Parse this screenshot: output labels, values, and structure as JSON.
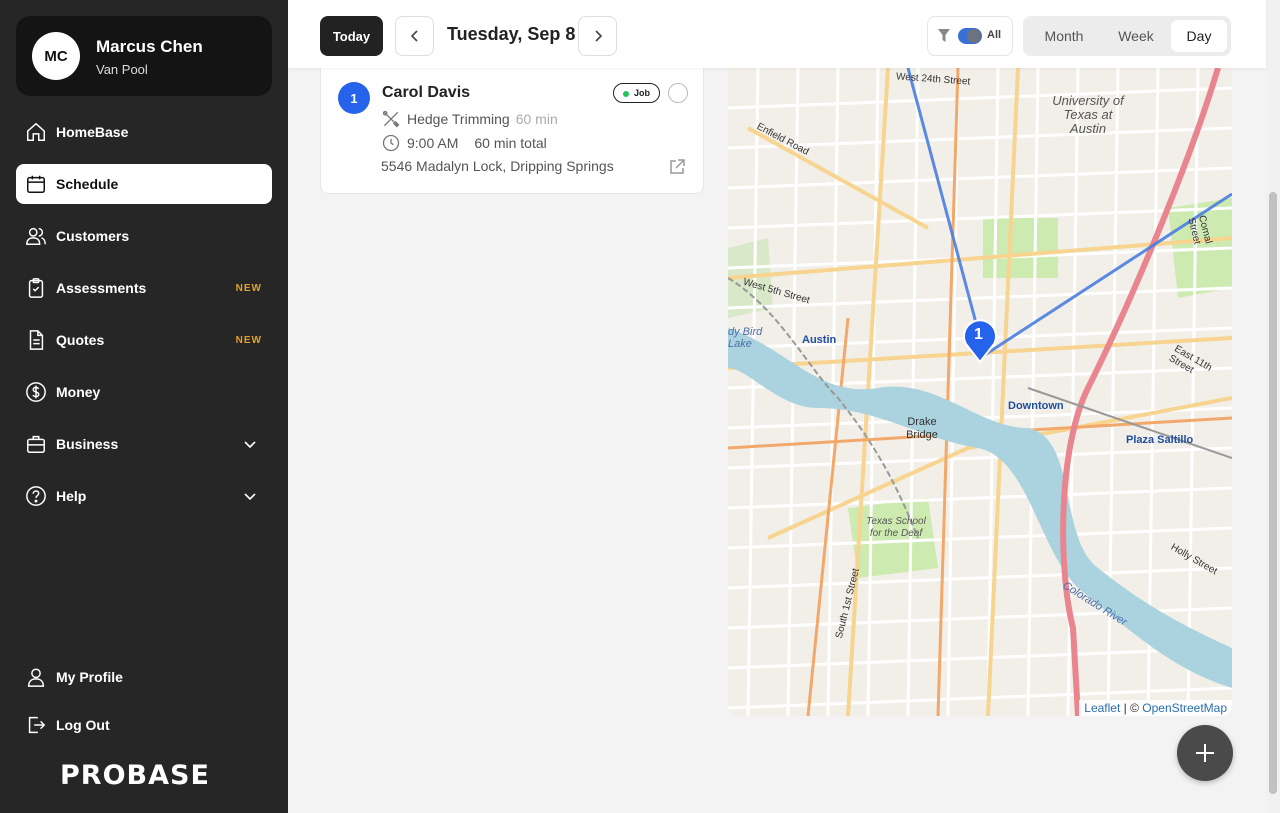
{
  "user": {
    "initials": "MC",
    "name": "Marcus Chen",
    "role": "Van Pool"
  },
  "nav": {
    "homebase": "HomeBase",
    "schedule": "Schedule",
    "customers": "Customers",
    "assessments": "Assessments",
    "assessments_badge": "NEW",
    "quotes": "Quotes",
    "quotes_badge": "NEW",
    "money": "Money",
    "business": "Business",
    "help": "Help",
    "profile": "My Profile",
    "logout": "Log Out"
  },
  "logo": "PROBASE",
  "toolbar": {
    "today": "Today",
    "date": "Tuesday, Sep 8",
    "filter_label": "All",
    "views": [
      "Month",
      "Week",
      "Day"
    ],
    "active_view": "Day"
  },
  "job": {
    "number": "1",
    "customer": "Carol Davis",
    "type_badge": "Job",
    "service": "Hedge Trimming",
    "service_duration": "60 min",
    "time": "9:00 AM",
    "total": "60 min total",
    "address": "5546 Madalyn Lock, Dripping Springs"
  },
  "map": {
    "labels": {
      "university": "University of Texas at Austin",
      "austin": "Austin",
      "downtown": "Downtown",
      "drake": "Drake Bridge",
      "plaza": "Plaza Saltillo",
      "texas_school": "Texas School for the Deaf",
      "colorado": "Colorado River",
      "lady_bird": "dy Bird Lake",
      "w24": "West 24th Street",
      "w5": "West 5th Street",
      "enfield": "Enfield Road",
      "e11": "East 11th Street",
      "holly": "Holly Street",
      "s1st": "South 1st Street",
      "comal": "Comal Street"
    },
    "marker": "1",
    "attribution_leaflet": "Leaflet",
    "attribution_sep": " | © ",
    "attribution_osm": "OpenStreetMap"
  },
  "colors": {
    "accent": "#2563eb",
    "sidebar": "#262626",
    "route": "#4a7de0",
    "highway": "#e8858f",
    "water": "#aad3df"
  }
}
